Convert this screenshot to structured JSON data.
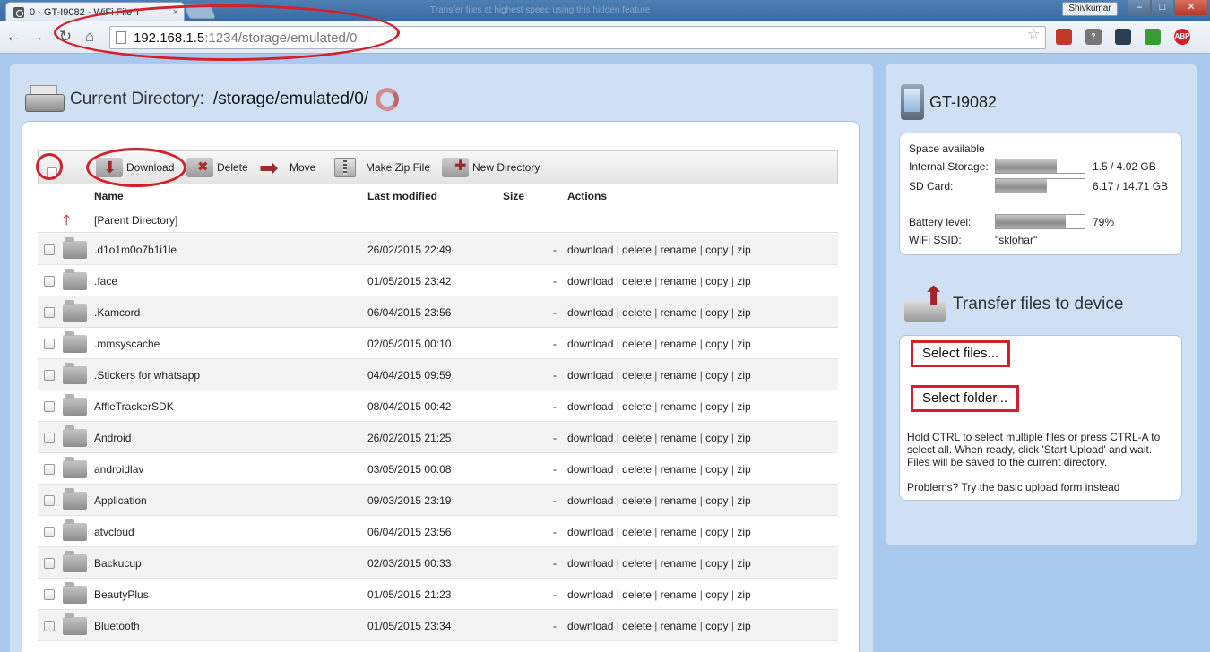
{
  "browser": {
    "tab_title": "0 - GT-I9082 - WiFi File T",
    "tab_close": "×",
    "blurred_tab": "Transfer files at highest speed using this hidden feature",
    "user": "Shivkumar",
    "url_host": "192.168.1.5",
    "url_path": ":1234/storage/emulated/0",
    "win_minimize": "–",
    "win_maximize": "□",
    "win_close": "✕",
    "extensions": [
      {
        "name": "bookmark-red",
        "color": "#c0392b",
        "label": ""
      },
      {
        "name": "help",
        "color": "#777777",
        "label": "?"
      },
      {
        "name": "chrome-dark",
        "color": "#2c3e50",
        "label": ""
      },
      {
        "name": "green",
        "color": "#3a9b35",
        "label": ""
      },
      {
        "name": "adblock-plus",
        "color": "#d4202a",
        "label": "ABP"
      }
    ]
  },
  "main": {
    "dir_label": "Current Directory:",
    "dir_path": "/storage/emulated/0/",
    "toolbar": {
      "download": "Download",
      "delete": "Delete",
      "move": "Move",
      "zip": "Make Zip File",
      "new_dir": "New Directory"
    },
    "headers": {
      "name": "Name",
      "modified": "Last modified",
      "size": "Size",
      "actions": "Actions"
    },
    "parent_label": "[Parent Directory]",
    "action_links": [
      "download",
      "delete",
      "rename",
      "copy",
      "zip"
    ],
    "rows": [
      {
        "name": ".d1o1m0o7b1i1le",
        "date": "26/02/2015 22:49",
        "size": "-"
      },
      {
        "name": ".face",
        "date": "01/05/2015 23:42",
        "size": "-"
      },
      {
        "name": ".Kamcord",
        "date": "06/04/2015 23:56",
        "size": "-"
      },
      {
        "name": ".mmsyscache",
        "date": "02/05/2015 00:10",
        "size": "-"
      },
      {
        "name": ".Stickers for whatsapp",
        "date": "04/04/2015 09:59",
        "size": "-"
      },
      {
        "name": "AffleTrackerSDK",
        "date": "08/04/2015 00:42",
        "size": "-"
      },
      {
        "name": "Android",
        "date": "26/02/2015 21:25",
        "size": "-"
      },
      {
        "name": "androidlav",
        "date": "03/05/2015 00:08",
        "size": "-"
      },
      {
        "name": "Application",
        "date": "09/03/2015 23:19",
        "size": "-"
      },
      {
        "name": "atvcloud",
        "date": "06/04/2015 23:56",
        "size": "-"
      },
      {
        "name": "Backucup",
        "date": "02/03/2015 00:33",
        "size": "-"
      },
      {
        "name": "BeautyPlus",
        "date": "01/05/2015 21:23",
        "size": "-"
      },
      {
        "name": "Bluetooth",
        "date": "01/05/2015 23:34",
        "size": "-"
      }
    ]
  },
  "side": {
    "device_name": "GT-I9082",
    "space_label": "Space available",
    "internal_label": "Internal Storage:",
    "internal_value": "1.5 / 4.02 GB",
    "internal_fill": 0.69,
    "sd_label": "SD Card:",
    "sd_value": "6.17 / 14.71 GB",
    "sd_fill": 0.58,
    "battery_label": "Battery level:",
    "battery_value": "79%",
    "battery_fill": 0.79,
    "ssid_label": "WiFi SSID:",
    "ssid_value": "\"sklohar\"",
    "transfer_title": "Transfer files to device",
    "select_files": "Select files...",
    "select_folder": "Select folder...",
    "help_text": "Hold CTRL to select multiple files or press CTRL-A to select all. When ready, click 'Start Upload' and wait. Files will be saved to the current directory.",
    "help_alt": "Problems? Try the basic upload form instead"
  }
}
